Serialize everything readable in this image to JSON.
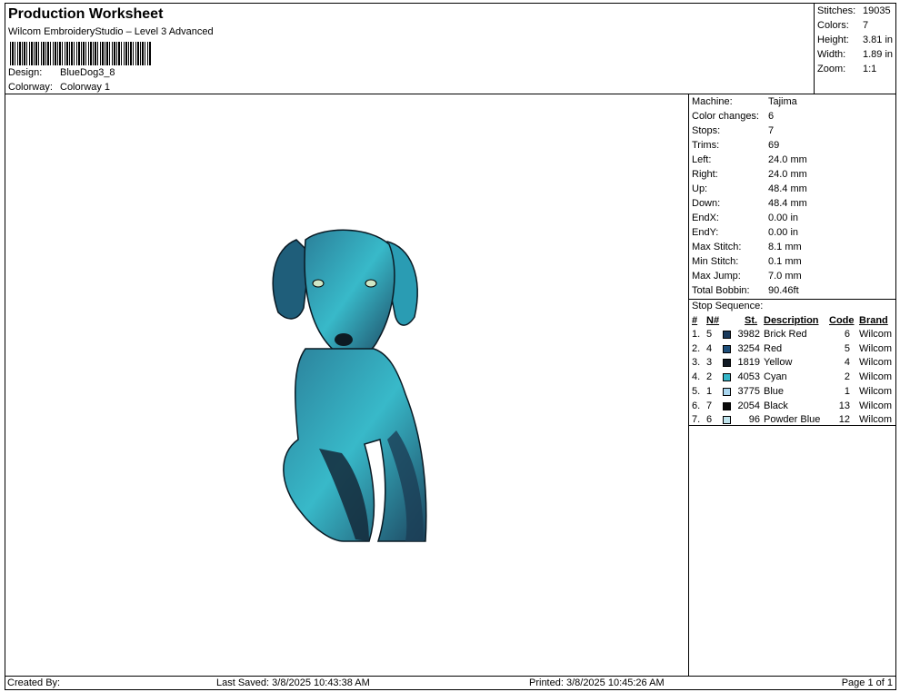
{
  "header": {
    "title": "Production Worksheet",
    "software": "Wilcom EmbroideryStudio – Level 3 Advanced",
    "design_label": "Design:",
    "design_value": "BlueDog3_8",
    "colorway_label": "Colorway:",
    "colorway_value": "Colorway 1"
  },
  "summary": [
    {
      "label": "Stitches:",
      "value": "19035"
    },
    {
      "label": "Colors:",
      "value": "7"
    },
    {
      "label": "Height:",
      "value": "3.81 in"
    },
    {
      "label": "Width:",
      "value": "1.89 in"
    },
    {
      "label": "Zoom:",
      "value": "1:1"
    }
  ],
  "machine_info": [
    {
      "label": "Machine:",
      "value": "Tajima"
    },
    {
      "label": "Color changes:",
      "value": "6"
    },
    {
      "label": "Stops:",
      "value": "7"
    },
    {
      "label": "Trims:",
      "value": "69"
    },
    {
      "label": "Left:",
      "value": "24.0 mm"
    },
    {
      "label": "Right:",
      "value": "24.0 mm"
    },
    {
      "label": "Up:",
      "value": "48.4 mm"
    },
    {
      "label": "Down:",
      "value": "48.4 mm"
    },
    {
      "label": "EndX:",
      "value": "0.00 in"
    },
    {
      "label": "EndY:",
      "value": "0.00 in"
    },
    {
      "label": "Max Stitch:",
      "value": "8.1 mm"
    },
    {
      "label": "Min Stitch:",
      "value": "0.1 mm"
    },
    {
      "label": "Max Jump:",
      "value": "7.0 mm"
    },
    {
      "label": "Total Bobbin:",
      "value": "90.46ft"
    }
  ],
  "stop_sequence": {
    "title": "Stop Sequence:",
    "headers": {
      "num": "#",
      "n": "N#",
      "st": "St.",
      "desc": "Description",
      "code": "Code",
      "brand": "Brand"
    },
    "rows": [
      {
        "num": "1.",
        "n": "5",
        "color": "#1a3a5c",
        "st": "3982",
        "desc": "Brick Red",
        "code": "6",
        "brand": "Wilcom"
      },
      {
        "num": "2.",
        "n": "4",
        "color": "#1f4f7a",
        "st": "3254",
        "desc": "Red",
        "code": "5",
        "brand": "Wilcom"
      },
      {
        "num": "3.",
        "n": "3",
        "color": "#111a24",
        "st": "1819",
        "desc": "Yellow",
        "code": "4",
        "brand": "Wilcom"
      },
      {
        "num": "4.",
        "n": "2",
        "color": "#35b6c9",
        "st": "4053",
        "desc": "Cyan",
        "code": "2",
        "brand": "Wilcom"
      },
      {
        "num": "5.",
        "n": "1",
        "color": "#a9d6ef",
        "st": "3775",
        "desc": "Blue",
        "code": "1",
        "brand": "Wilcom"
      },
      {
        "num": "6.",
        "n": "7",
        "color": "#0a0a0a",
        "st": "2054",
        "desc": "Black",
        "code": "13",
        "brand": "Wilcom"
      },
      {
        "num": "7.",
        "n": "6",
        "color": "#bfe3ec",
        "st": "96",
        "desc": "Powder Blue",
        "code": "12",
        "brand": "Wilcom"
      }
    ]
  },
  "footer": {
    "created_by": "Created By:",
    "last_saved": "Last Saved: 3/8/2025 10:43:38 AM",
    "printed": "Printed: 3/8/2025 10:45:26 AM",
    "page": "Page 1 of 1"
  }
}
